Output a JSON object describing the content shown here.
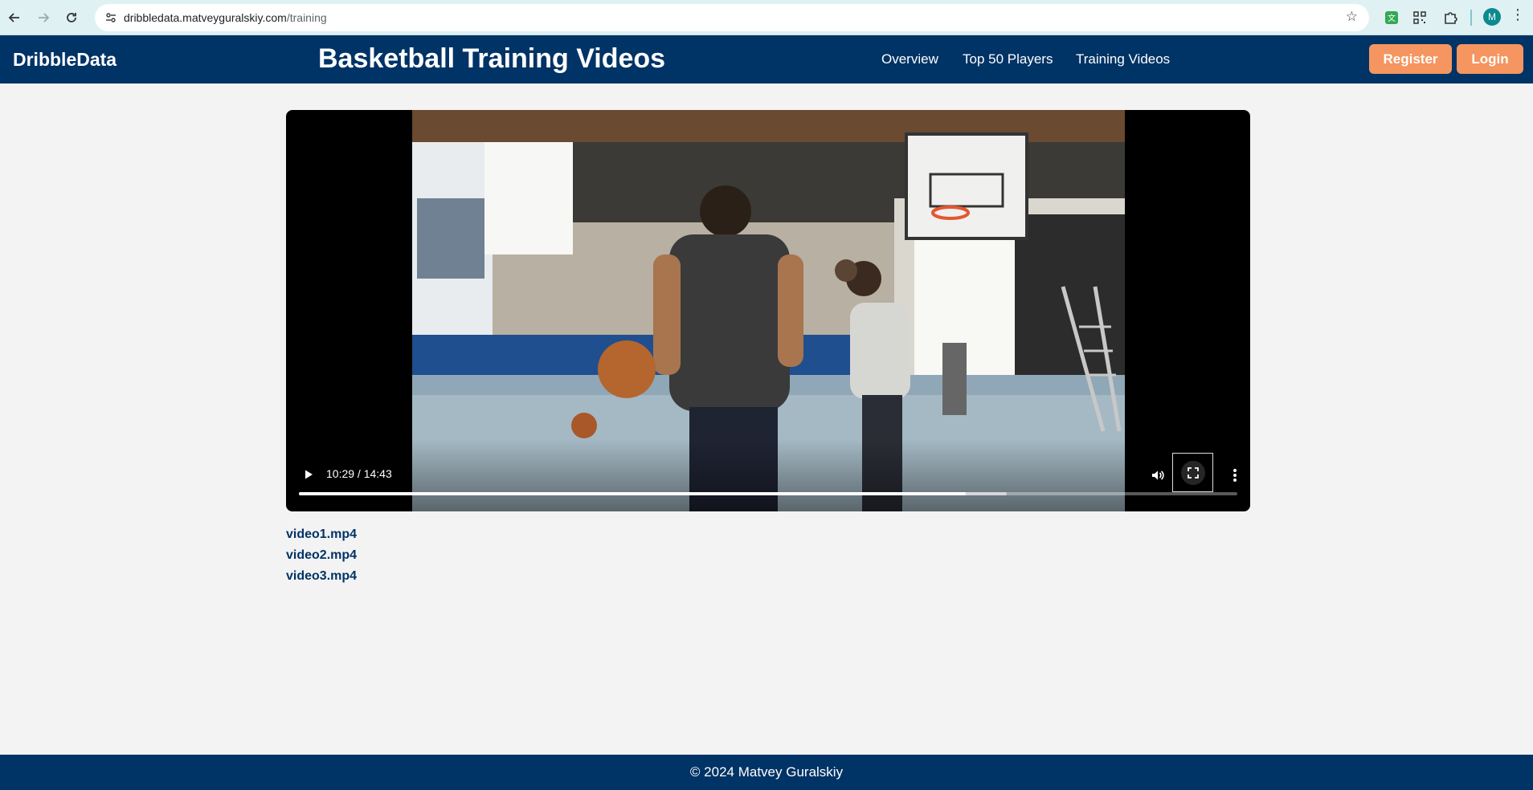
{
  "browser": {
    "url_host": "dribbledata.matveyguralskiy.com",
    "url_path": "/training",
    "profile_initial": "M"
  },
  "header": {
    "logo": "DribbleData",
    "title": "Basketball Training Videos",
    "nav": [
      "Overview",
      "Top 50 Players",
      "Training Videos"
    ],
    "register_label": "Register",
    "login_label": "Login"
  },
  "player": {
    "time": "10:29 / 14:43",
    "progress_fraction": 0.711,
    "buffered_fraction": 0.754
  },
  "videos": [
    "video1.mp4",
    "video2.mp4",
    "video3.mp4"
  ],
  "footer": {
    "copyright": "© 2024 Matvey Guralskiy"
  },
  "colors": {
    "brand_navy": "#003366",
    "accent_orange": "#f5955f",
    "page_bg": "#f3f3f3"
  }
}
